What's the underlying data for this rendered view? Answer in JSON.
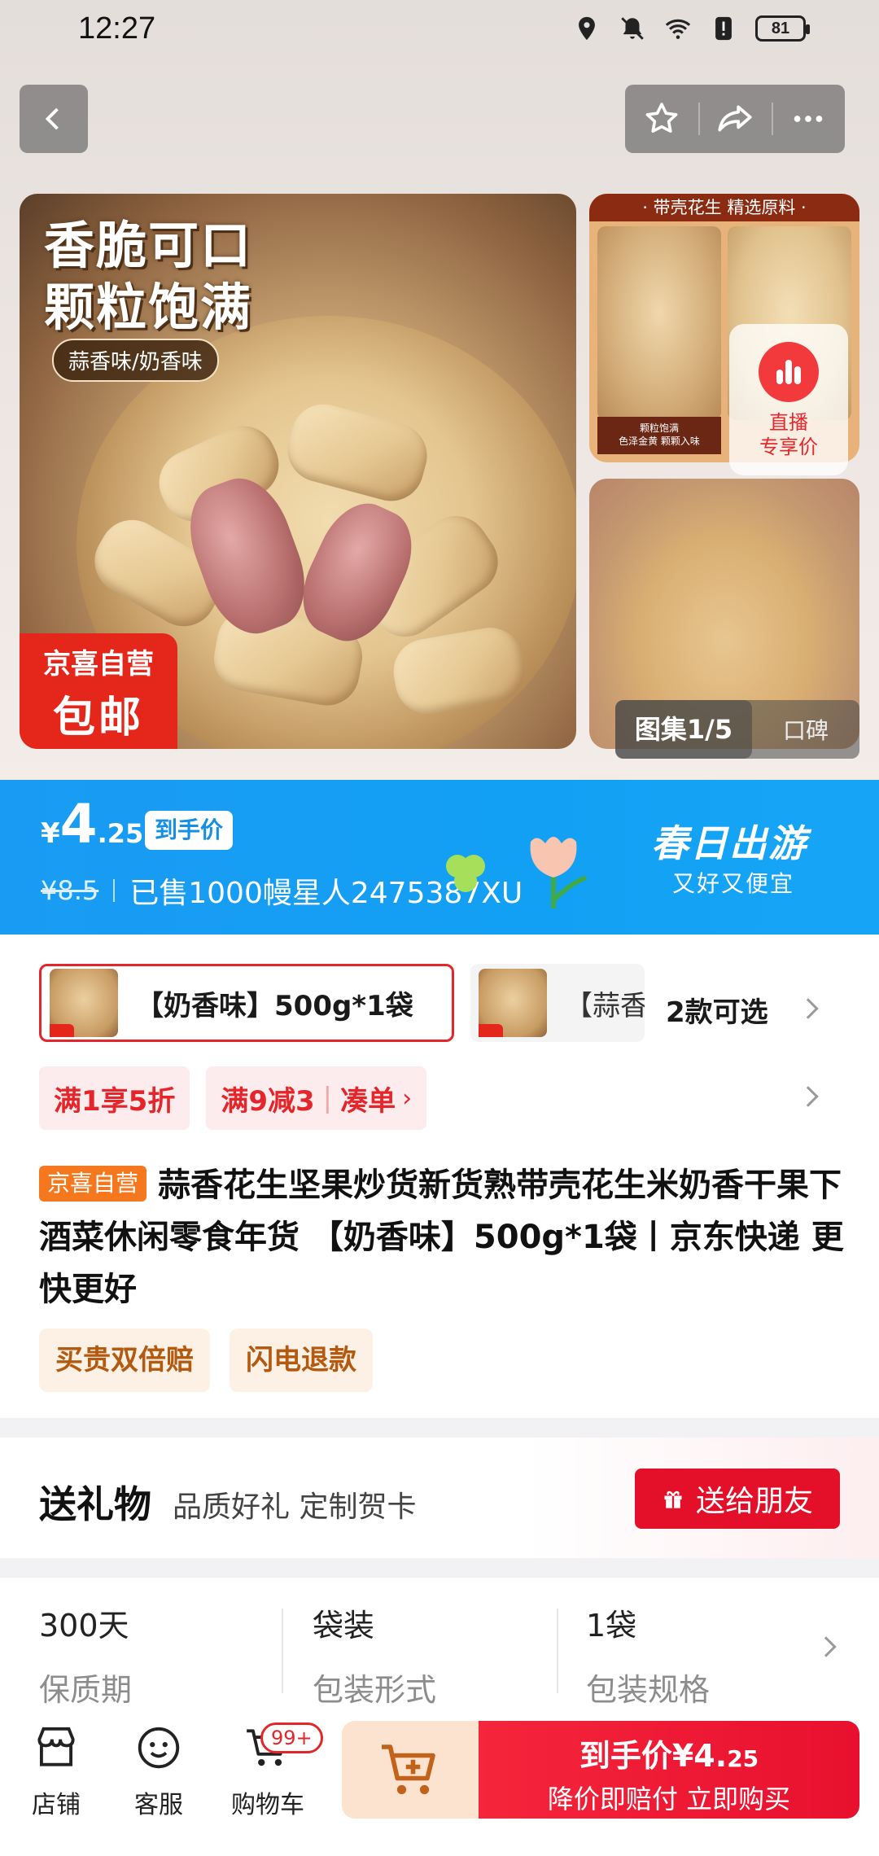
{
  "status": {
    "time": "12:27",
    "battery": "81"
  },
  "nav": {
    "back_icon": "chevron-left-icon",
    "star_icon": "star-outline-icon",
    "share_icon": "share-arrow-icon",
    "more_icon": "more-dots-icon"
  },
  "gallery": {
    "main_title_line1": "香脆可口",
    "main_title_line2": "颗粒饱满",
    "flavor_tag": "蒜香味/奶香味",
    "badge_line1": "京喜自营",
    "badge_line2": "包邮",
    "thumb_banner": "· 带壳花生   精选原料 ·",
    "thumb_caption_line1": "颗粒饱满",
    "thumb_caption_line2": "色泽金黄 颗颗入味",
    "live_line1": "直播",
    "live_line2": "专享价",
    "counter": "图集1/5",
    "review_tab": "口碑"
  },
  "price": {
    "currency": "¥",
    "integer": "4",
    "decimal": ".25",
    "tag": "到手价",
    "original": "¥8.5",
    "sold": "已售1000",
    "ticker": "幔星人2475387XU",
    "promo_title": "春日出游",
    "promo_sub": "又好又便宜"
  },
  "sku": {
    "selected_label": "【奶香味】500g*1袋",
    "other_label": "【蒜香",
    "count": "2款可选"
  },
  "promos": {
    "chip1": "满1享5折",
    "chip2_part1": "满9减3",
    "chip2_part2": "凑单"
  },
  "product": {
    "self_tag": "京喜自营",
    "title": "蒜香花生坚果炒货新货熟带壳花生米奶香干果下酒菜休闲零食年货 【奶香味】500g*1袋丨京东快递 更快更好",
    "guarantee1": "买贵双倍赔",
    "guarantee2": "闪电退款"
  },
  "gift": {
    "title": "送礼物",
    "subtitle": "品质好礼 定制贺卡",
    "button": "送给朋友"
  },
  "specs": [
    {
      "value": "300天",
      "key": "保质期"
    },
    {
      "value": "袋装",
      "key": "包装形式"
    },
    {
      "value": "1袋",
      "key": "包装规格"
    }
  ],
  "bottom": {
    "shop": "店铺",
    "service": "客服",
    "cart": "购物车",
    "cart_badge": "99+",
    "buy_line1_prefix": "到手价",
    "buy_line1_price": "¥4.",
    "buy_line1_decimal": "25",
    "buy_line2": "降价即赔付 立即购买"
  },
  "colors": {
    "brand_red": "#e4262b",
    "price_blue": "#1a9bf3",
    "self_orange": "#f5781e"
  }
}
